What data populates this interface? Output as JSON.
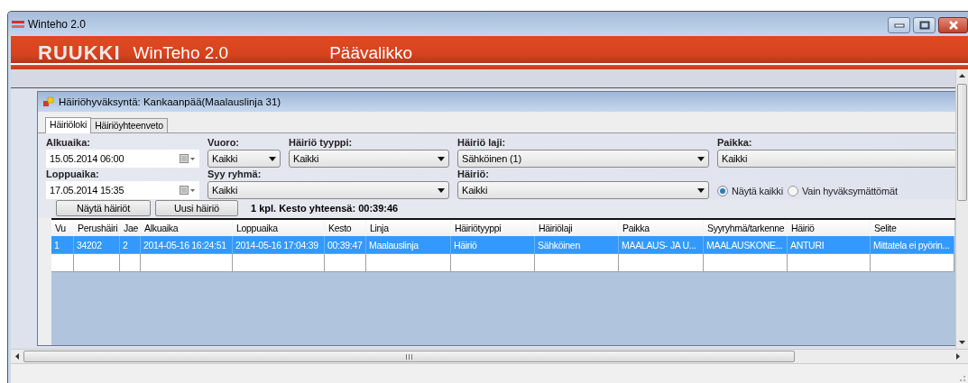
{
  "window": {
    "title": "Winteho 2.0"
  },
  "banner": {
    "logo": "RUUKKI",
    "app_name": "WinTeho 2.0",
    "title": "Päävalikko"
  },
  "child_window": {
    "title": "Häiriöhyväksyntä: Kankaanpää(Maalauslinja 31)"
  },
  "tabs": [
    {
      "label": "Häiriöloki",
      "selected": true
    },
    {
      "label": "Häiriöyhteenveto",
      "selected": false
    }
  ],
  "filters": [
    {
      "label": "Alkuaika:",
      "value": "15.05.2014 06:00",
      "kind": "date"
    },
    {
      "label": "Vuoro:",
      "value": "Kaikki",
      "kind": "select"
    },
    {
      "label": "Häiriö tyyppi:",
      "value": "Kaikki",
      "kind": "select"
    },
    {
      "label": "Häiriö laji:",
      "value": "Sähköinen (1)",
      "kind": "select"
    },
    {
      "label": "Paikka:",
      "value": "Kaikki",
      "kind": "select"
    },
    {
      "label": "Loppuaika:",
      "value": "17.05.2014 15:35",
      "kind": "date"
    },
    {
      "label": "Syy ryhmä:",
      "value": "Kaikki",
      "kind": "select"
    },
    {
      "label": "Häiriö:",
      "value": "Kaikki",
      "kind": "select"
    }
  ],
  "radios": [
    {
      "label": "Näytä kaikki",
      "selected": true
    },
    {
      "label": "Vain hyväksymättömät",
      "selected": false
    }
  ],
  "buttons": [
    "Näytä häiriöt",
    "Uusi häiriö"
  ],
  "summary": "1 kpl. Kesto yhteensä: 00:39:46",
  "table": {
    "columns": [
      "Vu",
      "Perushäiri",
      "Jae",
      "Alkuaika",
      "Loppuaika",
      "Kesto",
      "Linja",
      "Häiriötyyppi",
      "Häiriölaji",
      "Paikka",
      "Syyryhmä/tarkenne",
      "Häiriö",
      "Selite"
    ],
    "rows": [
      {
        "selected": true,
        "cells": [
          "1",
          "34202",
          "2",
          "2014-05-16 16:24:51",
          "2014-05-16 17:04:39",
          "00:39:47",
          "Maalauslinja",
          "Häiriö",
          "Sähköinen",
          "MAALAUS- JA U...",
          "MAALAUSKONE...",
          "ANTURI",
          "Mittatela ei pyörin..."
        ]
      }
    ]
  }
}
